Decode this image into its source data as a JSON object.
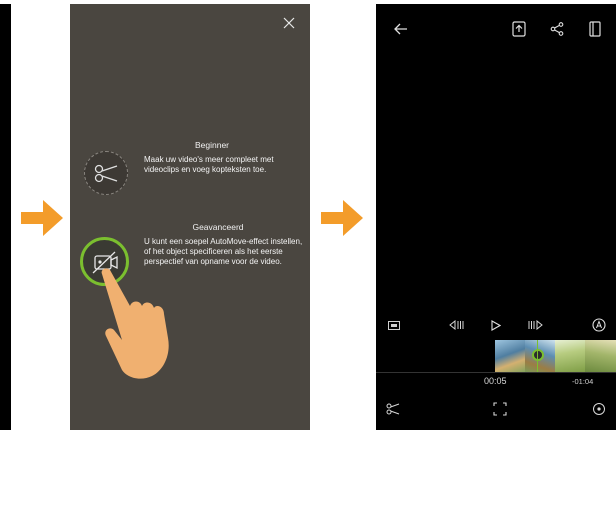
{
  "tutorial": {
    "close_icon": "close-icon",
    "beginner": {
      "title": "Beginner",
      "description": "Maak uw video's meer compleet met videoclips en voeg kopteksten toe.",
      "icon": "scissors-icon"
    },
    "advanced": {
      "title": "Geavanceerd",
      "description": "U kunt een soepel AutoMove-effect instellen, of het object specificeren als het eerste perspectief van opname voor de video.",
      "icon": "automove-icon"
    }
  },
  "editor": {
    "toolbar_icons": [
      "back-icon",
      "export-icon",
      "share-icon",
      "layout-icon"
    ],
    "controls": [
      "aspect-ratio-icon",
      "previous-frame-icon",
      "play-icon",
      "next-frame-icon",
      "automove-toggle-icon"
    ],
    "time_current": "00:05",
    "time_remaining": "-01:04",
    "bottom_icons": [
      "cut-icon",
      "fullscreen-icon",
      "rotate-icon"
    ]
  },
  "colors": {
    "arrow": "#f39c2a",
    "accent_green": "#7bbf2f",
    "overlay_bg": "#4a4640",
    "hand": "#f0b070"
  }
}
